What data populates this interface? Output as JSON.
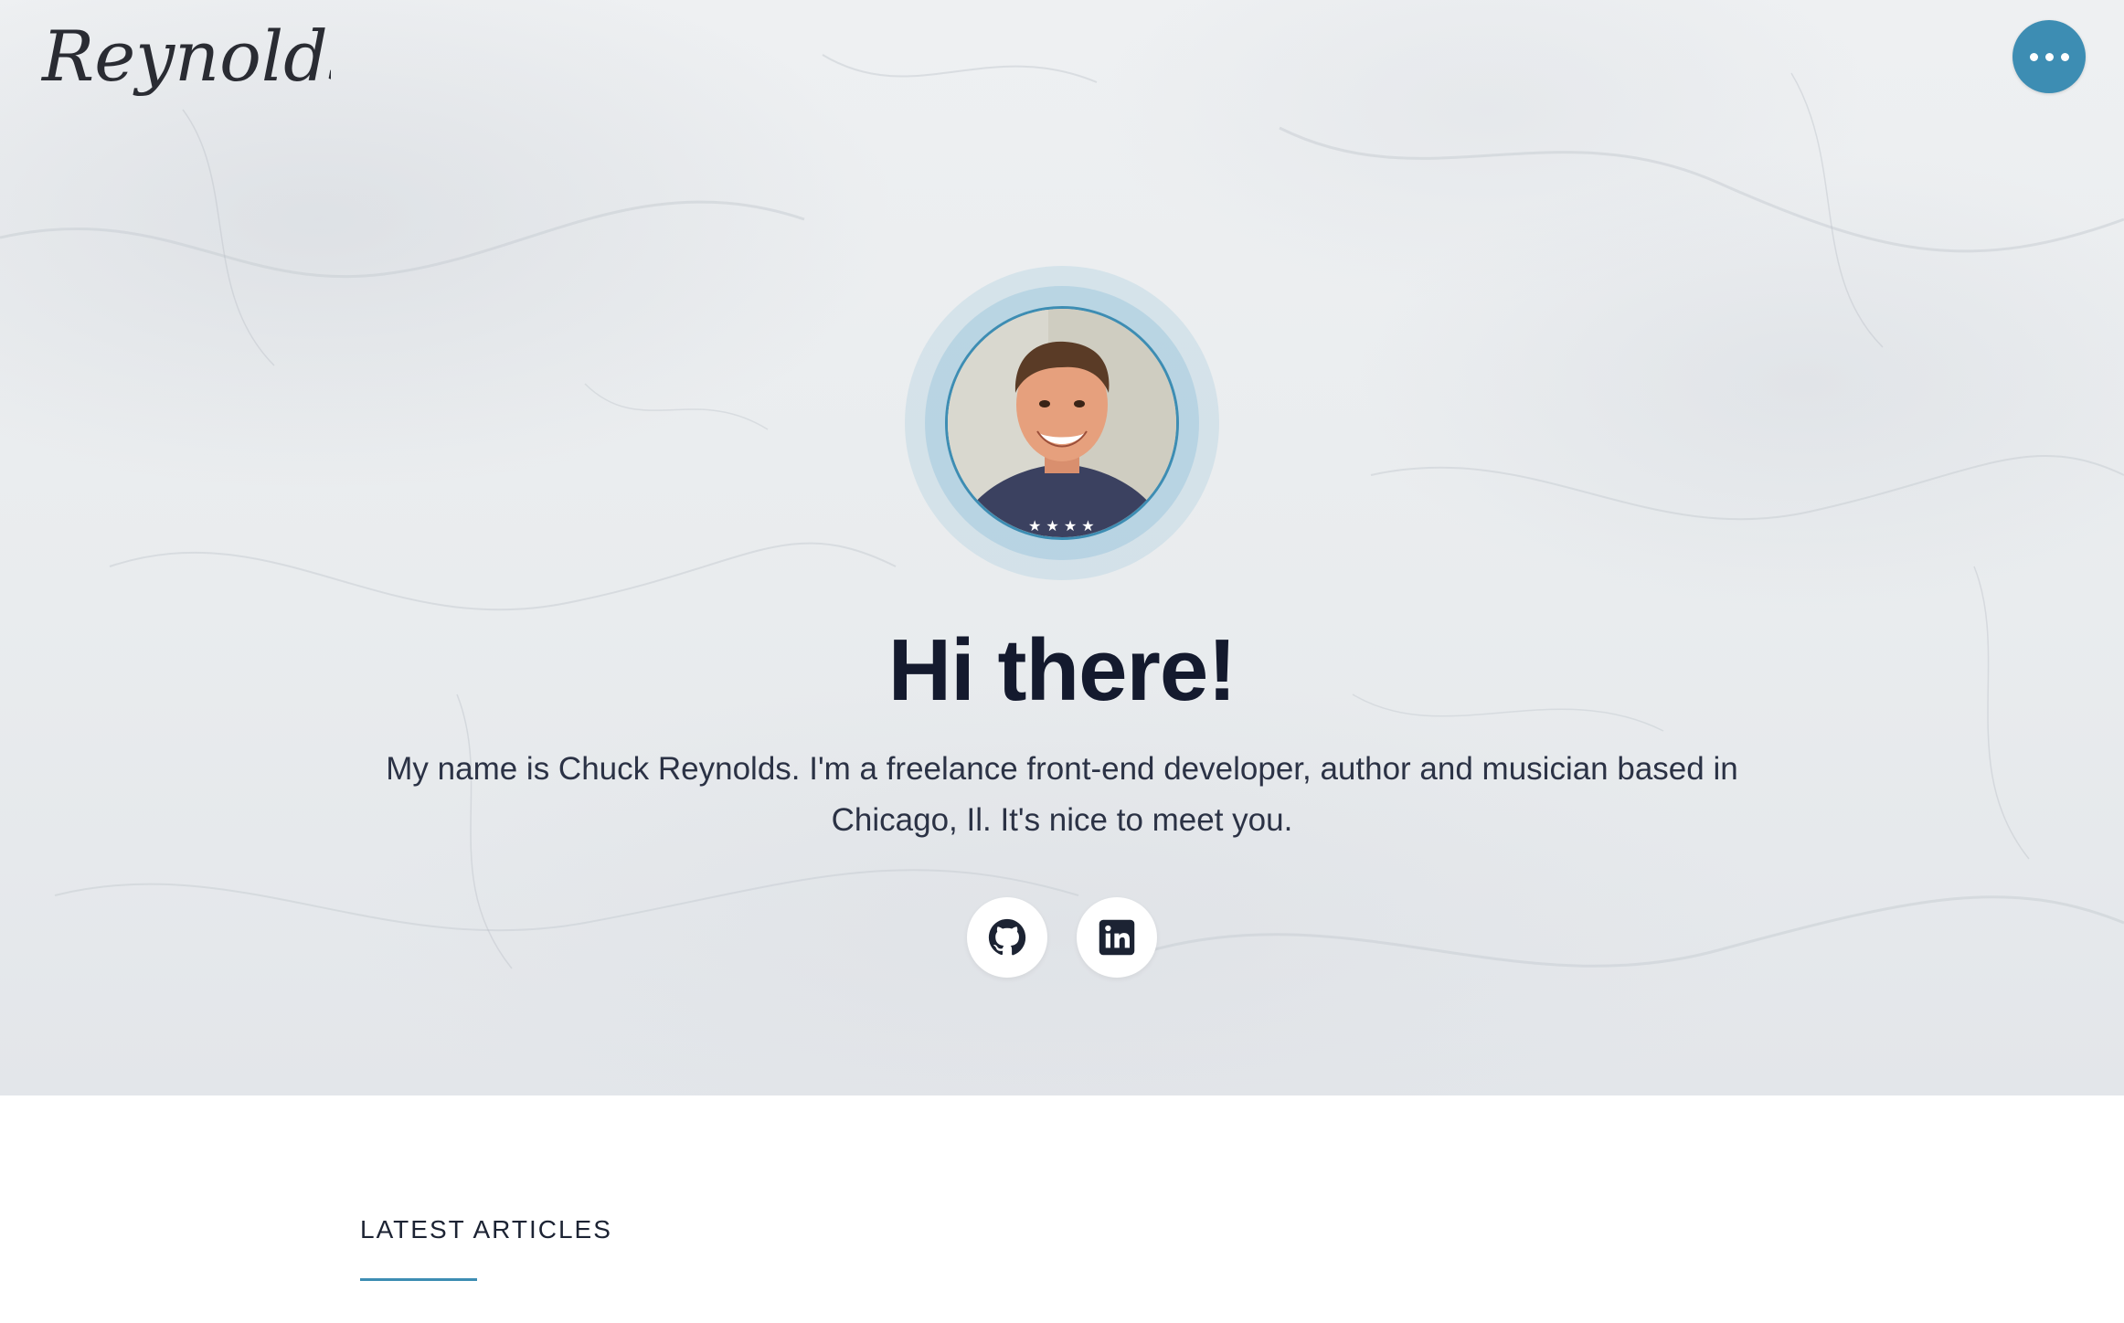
{
  "header": {
    "logo_text": "Reynolds",
    "menu_icon": "more-dots-icon"
  },
  "hero": {
    "avatar_icon": "profile-photo",
    "headline": "Hi there!",
    "intro": "My name is Chuck Reynolds. I'm a freelance front-end developer, author and musician based in Chicago, Il. It's nice to meet you.",
    "social": [
      {
        "icon": "github-icon"
      },
      {
        "icon": "linkedin-icon"
      }
    ]
  },
  "articles": {
    "heading": "LATEST ARTICLES"
  },
  "colors": {
    "accent": "#3d8db3",
    "heading": "#141a2e",
    "body_text": "#2b3245"
  }
}
